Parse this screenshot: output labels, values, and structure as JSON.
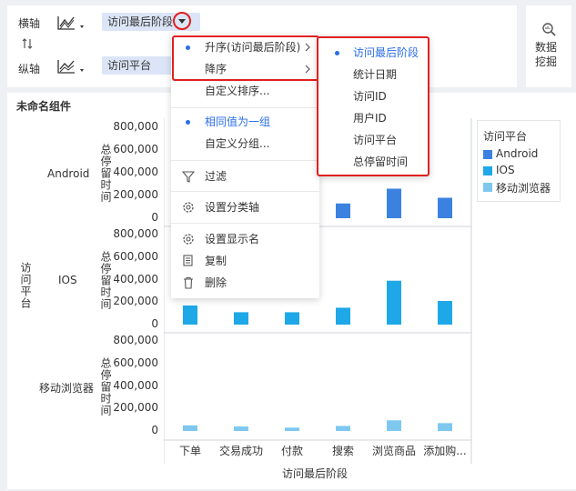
{
  "toolbar": {
    "x_axis_label": "横轴",
    "y_axis_label": "纵轴",
    "x_field": "访问最后阶段",
    "y_field": "访问平台",
    "swap_icon": "swap-vertical-icon",
    "data_mining": "数据挖掘"
  },
  "component": {
    "title": "未命名组件",
    "row_dim_label": "访问平台",
    "x_axis_title": "访问最后阶段",
    "value_axis_label": "总停留时间",
    "categories": [
      "下单",
      "交易成功",
      "付款",
      "搜索",
      "浏览商品",
      "添加购..."
    ],
    "rows": [
      "Android",
      "IOS",
      "移动浏览器"
    ],
    "ticks": [
      "800,000",
      "600,000",
      "400,000",
      "200,000",
      "0"
    ]
  },
  "legend": {
    "title": "访问平台",
    "items": [
      {
        "label": "Android",
        "color": "#3b82e0"
      },
      {
        "label": "IOS",
        "color": "#1ea8e8"
      },
      {
        "label": "移动浏览器",
        "color": "#7ec8f0"
      }
    ]
  },
  "context_menu": {
    "items": [
      {
        "label": "升序(访问最后阶段)",
        "active": true,
        "bullet": true,
        "submenu": true
      },
      {
        "label": "降序",
        "active": false,
        "bullet": false,
        "submenu": true
      },
      {
        "label": "自定义排序...",
        "active": false,
        "bullet": false,
        "submenu": false
      },
      {
        "label": "相同值为一组",
        "active": true,
        "bullet": true,
        "submenu": false
      },
      {
        "label": "自定义分组...",
        "active": false,
        "bullet": false,
        "submenu": false
      },
      {
        "label": "过滤",
        "icon": "filter-icon"
      },
      {
        "label": "设置分类轴",
        "icon": "gear-icon"
      },
      {
        "label": "设置显示名",
        "icon": "gear-icon"
      },
      {
        "label": "复制",
        "icon": "copy-icon"
      },
      {
        "label": "删除",
        "icon": "trash-icon"
      }
    ]
  },
  "submenu": {
    "items": [
      {
        "label": "访问最后阶段",
        "active": true
      },
      {
        "label": "统计日期",
        "active": false
      },
      {
        "label": "访问ID",
        "active": false
      },
      {
        "label": "用户ID",
        "active": false
      },
      {
        "label": "访问平台",
        "active": false
      },
      {
        "label": "总停留时间",
        "active": false
      }
    ]
  },
  "chart_data": {
    "type": "bar",
    "categories": [
      "下单",
      "交易成功",
      "付款",
      "搜索",
      "浏览商品",
      "添加购..."
    ],
    "ylim": [
      0,
      800000
    ],
    "xlabel": "访问最后阶段",
    "ylabel": "总停留时间",
    "series": [
      {
        "name": "Android",
        "color": "#3b82e0",
        "values": [
          0,
          0,
          0,
          130000,
          260000,
          180000
        ]
      },
      {
        "name": "IOS",
        "color": "#1ea8e8",
        "values": [
          170000,
          110000,
          110000,
          150000,
          390000,
          210000
        ]
      },
      {
        "name": "移动浏览器",
        "color": "#7ec8f0",
        "values": [
          50000,
          40000,
          30000,
          45000,
          95000,
          70000
        ]
      }
    ]
  }
}
